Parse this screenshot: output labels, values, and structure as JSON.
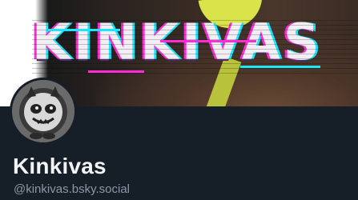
{
  "profile": {
    "banner_text": "KINKIVAS",
    "display_name": "Kinkivas",
    "handle": "@kinkivas.bsky.social"
  },
  "colors": {
    "background": "#161e27",
    "name": "#f1f3f5",
    "handle": "#8c98a6",
    "glitch_magenta": "#ff2bd6",
    "glitch_cyan": "#19e6ff"
  },
  "icons": {
    "avatar": "cat-mascot-avatar"
  }
}
